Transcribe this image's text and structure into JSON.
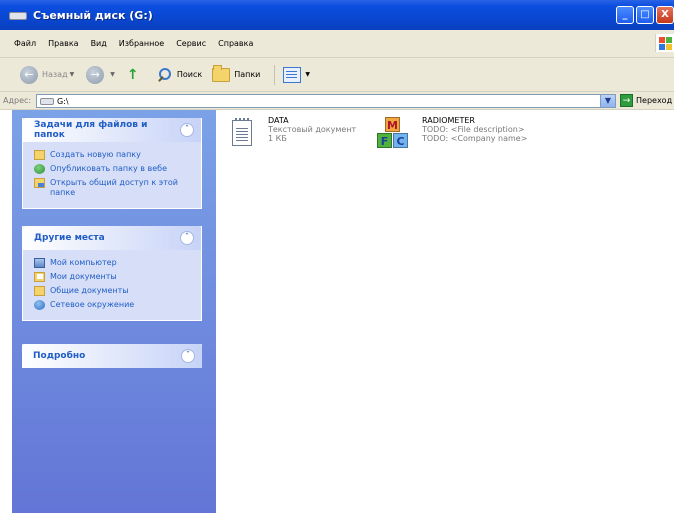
{
  "window": {
    "title": "Съемный диск (G:)",
    "buttons": [
      "_",
      "□",
      "X"
    ]
  },
  "menu": [
    "Файл",
    "Правка",
    "Вид",
    "Избранное",
    "Сервис",
    "Справка"
  ],
  "toolbar": {
    "back_label": "Назад",
    "search_label": "Поиск",
    "folders_label": "Папки"
  },
  "address": {
    "label": "Адрес:",
    "value": "G:\\",
    "go_label": "Переход"
  },
  "panels": {
    "tasks": {
      "title": "Задачи для файлов и папок",
      "items": [
        {
          "label": "Создать новую папку",
          "icon": "new-folder-icon"
        },
        {
          "label": "Опубликовать папку в вебе",
          "icon": "publish-web-icon"
        },
        {
          "label": "Открыть общий доступ к этой папке",
          "icon": "share-folder-icon"
        }
      ]
    },
    "places": {
      "title": "Другие места",
      "items": [
        {
          "label": "Мой компьютер",
          "icon": "my-computer-icon"
        },
        {
          "label": "Мои документы",
          "icon": "my-documents-icon"
        },
        {
          "label": "Общие документы",
          "icon": "shared-documents-icon"
        },
        {
          "label": "Сетевое окружение",
          "icon": "network-icon"
        }
      ]
    },
    "details": {
      "title": "Подробно"
    }
  },
  "files": [
    {
      "name": "DATA",
      "line2": "Текстовый документ",
      "line3": "1 КБ",
      "icon": "text-document-icon"
    },
    {
      "name": "RADIOMETER",
      "line2": "TODO: <File description>",
      "line3": "TODO: <Company name>",
      "icon": "application-icon"
    }
  ],
  "colors": {
    "titlebar": "#0a47d1",
    "link": "#215dc6",
    "panel_bg": "#d6dff7",
    "sidebar": "#6f8ce0"
  }
}
